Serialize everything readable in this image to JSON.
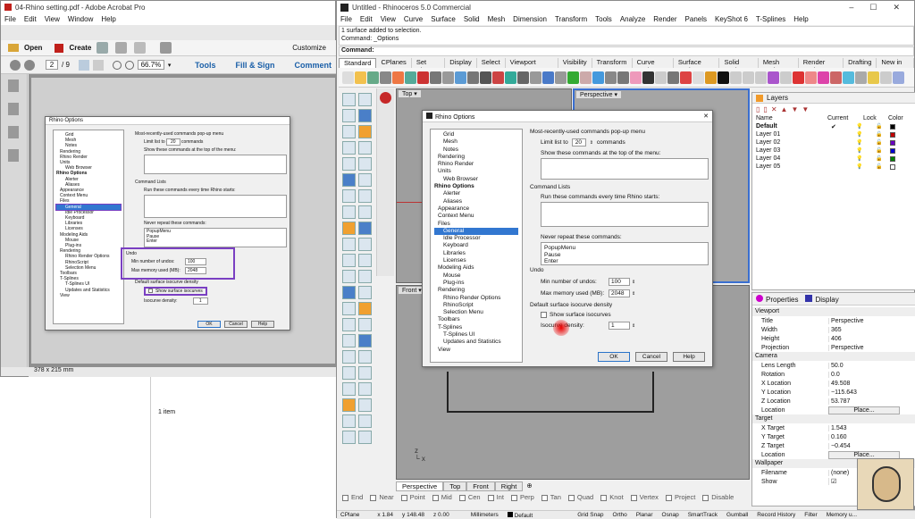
{
  "acrobat": {
    "title": "04-Rhino setting.pdf - Adobe Acrobat Pro",
    "menu": [
      "File",
      "Edit",
      "View",
      "Window",
      "Help"
    ],
    "toolbar": {
      "open": "Open",
      "create": "Create",
      "customize": "Customize"
    },
    "nav": {
      "page": "2",
      "total": "/ 9",
      "zoom": "66.7%",
      "tools": "Tools",
      "fill_sign": "Fill & Sign",
      "comment": "Comment"
    },
    "status_size": "378 x 215 mm",
    "explorer_status": "1 item"
  },
  "rhino": {
    "title": "Untitled - Rhinoceros 5.0 Commercial",
    "menu": [
      "File",
      "Edit",
      "View",
      "Curve",
      "Surface",
      "Solid",
      "Mesh",
      "Dimension",
      "Transform",
      "Tools",
      "Analyze",
      "Render",
      "Panels",
      "KeyShot 6",
      "T-Splines",
      "Help"
    ],
    "cmd_history": [
      "1 surface added to selection.",
      "Command: _Options"
    ],
    "cmd_label": "Command:",
    "tabs": [
      "Standard",
      "CPlanes",
      "Set View",
      "Display",
      "Select",
      "Viewport Layout",
      "Visibility",
      "Transform",
      "Curve Tools",
      "Surface Tools",
      "Solid Tools",
      "Mesh Tools",
      "Render Tools",
      "Drafting",
      "New in V5"
    ],
    "viewport_labels": {
      "top": "Top",
      "perspective": "Perspective",
      "front": "Front"
    },
    "view_tabs": [
      "Perspective",
      "Top",
      "Front",
      "Right"
    ],
    "osnaps": [
      "End",
      "Near",
      "Point",
      "Mid",
      "Cen",
      "Int",
      "Perp",
      "Tan",
      "Quad",
      "Knot",
      "Vertex",
      "Project",
      "Disable"
    ],
    "statusbar": {
      "cplane": "CPlane",
      "x": "x 1.84",
      "y": "y 148.48",
      "z": "z 0.00",
      "units": "Millimeters",
      "layer": "Default",
      "grid": "Grid Snap",
      "ortho": "Ortho",
      "planar": "Planar",
      "osnap": "Osnap",
      "smarttrack": "SmartTrack",
      "gumball": "Gumball",
      "history": "Record History",
      "filter": "Filter",
      "memory": "Memory u..."
    }
  },
  "layers": {
    "title": "Layers",
    "headers": {
      "name": "Name",
      "current": "Current",
      "lock": "Lock",
      "color": "Color"
    },
    "rows": [
      {
        "name": "Default",
        "current": "✔",
        "color": "#000000"
      },
      {
        "name": "Layer 01",
        "color": "#c00000"
      },
      {
        "name": "Layer 02",
        "color": "#6a00c0"
      },
      {
        "name": "Layer 03",
        "color": "#0000d0"
      },
      {
        "name": "Layer 04",
        "color": "#008000"
      },
      {
        "name": "Layer 05",
        "color": "#ffffff"
      }
    ]
  },
  "properties": {
    "tabs": [
      "Properties",
      "Display"
    ],
    "sections": [
      {
        "title": "Viewport",
        "rows": [
          [
            "Title",
            "Perspective"
          ],
          [
            "Width",
            "365"
          ],
          [
            "Height",
            "406"
          ],
          [
            "Projection",
            "Perspective"
          ]
        ]
      },
      {
        "title": "Camera",
        "rows": [
          [
            "Lens Length",
            "50.0"
          ],
          [
            "Rotation",
            "0.0"
          ],
          [
            "X Location",
            "49.508"
          ],
          [
            "Y Location",
            "−115.643"
          ],
          [
            "Z Location",
            "53.787"
          ],
          [
            "Location",
            "Place..."
          ]
        ]
      },
      {
        "title": "Target",
        "rows": [
          [
            "X Target",
            "1.543"
          ],
          [
            "Y Target",
            "0.160"
          ],
          [
            "Z Target",
            "−0.454"
          ],
          [
            "Location",
            "Place..."
          ]
        ]
      },
      {
        "title": "Wallpaper",
        "rows": [
          [
            "Filename",
            "(none)"
          ],
          [
            "Show",
            "☑"
          ]
        ]
      }
    ]
  },
  "options": {
    "title": "Rhino Options",
    "tree": [
      "Grid",
      "Mesh",
      "Notes",
      "Rendering",
      "Rhino Render",
      "Units",
      "Web Browser",
      "Rhino Options",
      "Alerter",
      "Aliases",
      "Appearance",
      "Context Menu",
      "Files",
      "General",
      "Idle Processor",
      "Keyboard",
      "Libraries",
      "Licenses",
      "Modeling Aids",
      "Mouse",
      "Plug-ins",
      "Rendering",
      "Rhino Render Options",
      "RhinoScript",
      "Selection Menu",
      "Toolbars",
      "T-Splines",
      "T-Splines UI",
      "Updates and Statistics",
      "View"
    ],
    "selected": "General",
    "recent_group": "Most-recently-used commands pop-up menu",
    "limit_label": "Limit list to",
    "limit_value": "20",
    "commands_label": "commands",
    "show_top_label": "Show these commands at the top of the menu:",
    "cmd_lists_group": "Command Lists",
    "run_label": "Run these commands every time Rhino starts:",
    "never_repeat_label": "Never repeat these commands:",
    "never_repeat_items": [
      "PopupMenu",
      "Pause",
      "Enter"
    ],
    "undo_group": "Undo",
    "min_undos_label": "Min number of undos:",
    "min_undos_value": "100",
    "max_mem_label": "Max memory used (MB):",
    "max_mem_value": "2048",
    "iso_group": "Default surface isocurve density",
    "show_iso_label": "Show surface isocurves",
    "iso_density_label": "Isocurve density:",
    "iso_density_value": "1",
    "ok": "OK",
    "cancel": "Cancel",
    "help": "Help"
  }
}
